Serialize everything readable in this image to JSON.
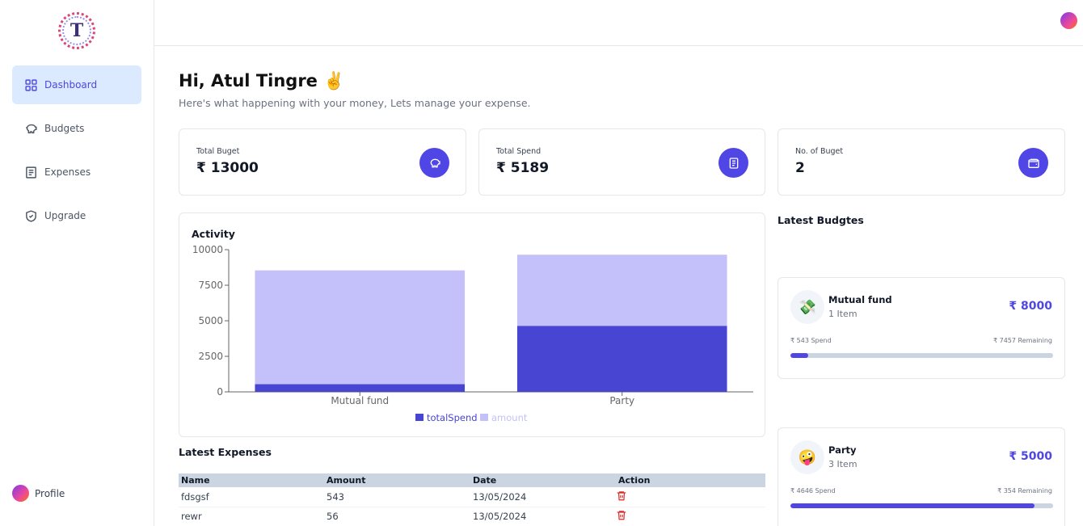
{
  "sidebar": {
    "logo_letter": "T",
    "items": [
      {
        "label": "Dashboard",
        "icon": "grid-icon",
        "active": true
      },
      {
        "label": "Budgets",
        "icon": "piggy-bank-icon",
        "active": false
      },
      {
        "label": "Expenses",
        "icon": "receipt-icon",
        "active": false
      },
      {
        "label": "Upgrade",
        "icon": "shield-check-icon",
        "active": false
      }
    ],
    "profile_label": "Profile"
  },
  "header": {
    "greeting": "Hi, Atul Tingre ✌️",
    "subtitle": "Here's what happening with your money, Lets manage your expense."
  },
  "cards": [
    {
      "label": "Total Buget",
      "value": "₹ 13000",
      "icon": "piggy-bank-icon"
    },
    {
      "label": "Total Spend",
      "value": "₹ 5189",
      "icon": "receipt-icon"
    },
    {
      "label": "No. of Buget",
      "value": "2",
      "icon": "wallet-icon"
    }
  ],
  "chart_data": {
    "type": "bar",
    "title": "Activity",
    "categories": [
      "Mutual fund",
      "Party"
    ],
    "series": [
      {
        "name": "totalSpend",
        "values": [
          543,
          4646
        ],
        "color": "#4845d2"
      },
      {
        "name": "amount",
        "values": [
          8000,
          5000
        ],
        "color": "#c3c0fa"
      }
    ],
    "stacked": true,
    "yticks": [
      0,
      2500,
      5000,
      7500,
      10000
    ],
    "ylim": [
      0,
      10000
    ],
    "legend_position": "bottom"
  },
  "expenses": {
    "title": "Latest Expenses",
    "columns": [
      "Name",
      "Amount",
      "Date",
      "Action"
    ],
    "rows": [
      {
        "name": "fdsgsf",
        "amount": "543",
        "date": "13/05/2024"
      },
      {
        "name": "rewr",
        "amount": "56",
        "date": "13/05/2024"
      }
    ]
  },
  "budgets": {
    "title": "Latest Budgtes",
    "items": [
      {
        "emoji": "💸",
        "name": "Mutual fund",
        "items": "1 Item",
        "amount": "₹ 8000",
        "spend": "₹ 543 Spend",
        "remaining": "₹ 7457 Remaining",
        "progress": 0.068
      },
      {
        "emoji": "🤪",
        "name": "Party",
        "items": "3 Item",
        "amount": "₹ 5000",
        "spend": "₹ 4646 Spend",
        "remaining": "₹ 354 Remaining",
        "progress": 0.929
      }
    ]
  },
  "colors": {
    "accent": "#4f46e5",
    "accent_light": "#dbeafe",
    "danger": "#dc2626"
  }
}
